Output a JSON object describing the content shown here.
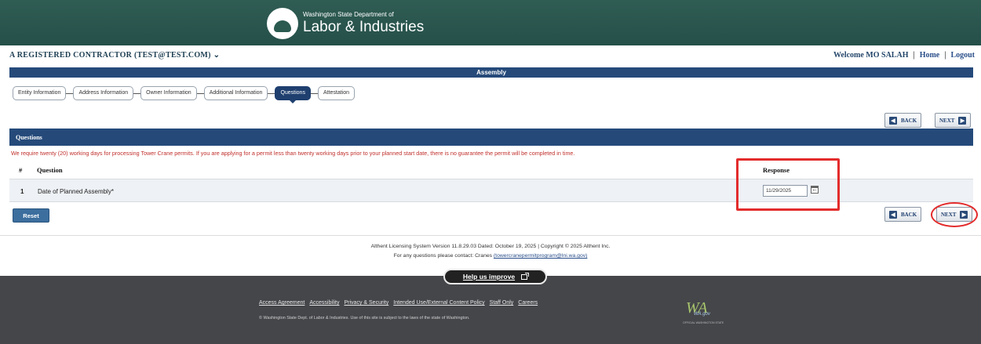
{
  "header": {
    "agency_small": "Washington State Department of",
    "agency_name": "Labor & Industries"
  },
  "userbar": {
    "account": "A REGISTERED CONTRACTOR (TEST@TEST.COM) ⌄",
    "welcome": "Welcome MO SALAH",
    "home": "Home",
    "logout": "Logout"
  },
  "page": {
    "section": "Assembly"
  },
  "steps": [
    {
      "label": "Entity Information",
      "active": false
    },
    {
      "label": "Address Information",
      "active": false
    },
    {
      "label": "Owner Information",
      "active": false
    },
    {
      "label": "Additional Information",
      "active": false
    },
    {
      "label": "Questions",
      "active": true
    },
    {
      "label": "Attestation",
      "active": false
    }
  ],
  "nav": {
    "back": "BACK",
    "next": "NEXT"
  },
  "questions": {
    "title": "Questions",
    "notice": "We require twenty (20) working days for processing Tower Crane permits. If you are applying for a permit less than twenty working days prior to your planned start date, there is no guarantee the permit will be completed in time.",
    "col_num": "#",
    "col_question": "Question",
    "col_response": "Response",
    "rows": [
      {
        "num": "1",
        "text": "Date of Planned Assembly*",
        "response": "11/29/2025"
      }
    ]
  },
  "buttons": {
    "reset": "Reset"
  },
  "footer": {
    "version": "Althent Licensing System Version 11.8.29.03 Dated: October 19, 2025 | Copyright © 2025 Althent Inc.",
    "contact_prefix": "For any questions please contact: Cranes",
    "contact_email": "(towercranepermitprogram@lni.wa.gov)",
    "help": "Help us improve",
    "links": [
      "Access Agreement",
      "Accessibility",
      "Privacy & Security",
      "Intended Use/External Content Policy",
      "Staff Only",
      "Careers"
    ],
    "legal": "© Washington State Dept. of Labor & Industries. Use of this site is subject to the laws of the state of Washington.",
    "wa_mark": "WA",
    "wa_text": "WA.gov",
    "wa_tag": "OFFICIAL WASHINGTON STATE"
  },
  "colors": {
    "banner": "#2a5a50",
    "nav_blue": "#254a7a",
    "notice_red": "#c0302c",
    "highlight_red": "#e32c2c",
    "footer": "#45464a"
  },
  "icons": [
    "logo-icon",
    "back-arrow-icon",
    "next-arrow-icon",
    "calendar-icon",
    "external-link-icon",
    "wa-gov-logo"
  ]
}
